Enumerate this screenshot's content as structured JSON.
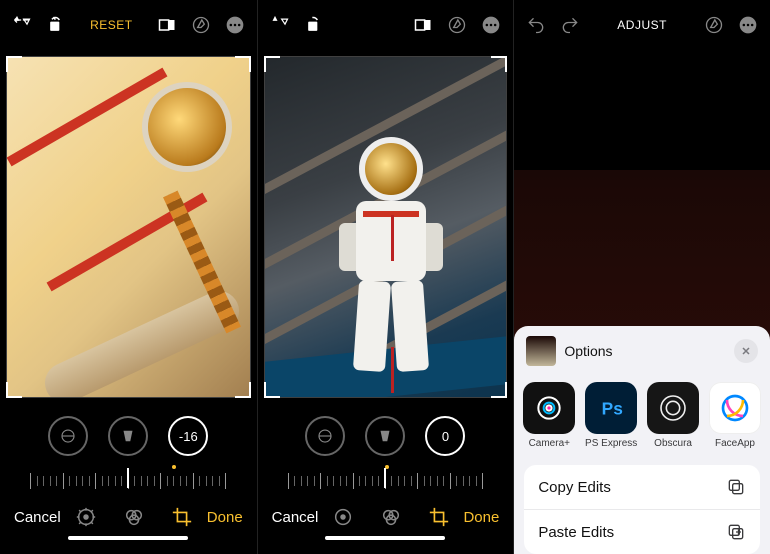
{
  "panel1": {
    "toolbar": {
      "reset_label": "RESET"
    },
    "tools": {
      "straighten_value": "-16"
    },
    "bottom": {
      "cancel_label": "Cancel",
      "done_label": "Done"
    }
  },
  "panel2": {
    "tools": {
      "straighten_value": "0"
    },
    "bottom": {
      "cancel_label": "Cancel",
      "done_label": "Done"
    }
  },
  "panel3": {
    "title": "ADJUST",
    "sheet": {
      "title": "Options",
      "apps": [
        {
          "label": "Camera+"
        },
        {
          "label": "PS Express"
        },
        {
          "label": "Obscura"
        },
        {
          "label": "FaceApp"
        }
      ],
      "actions": [
        {
          "label": "Copy Edits"
        },
        {
          "label": "Paste Edits"
        }
      ]
    }
  }
}
